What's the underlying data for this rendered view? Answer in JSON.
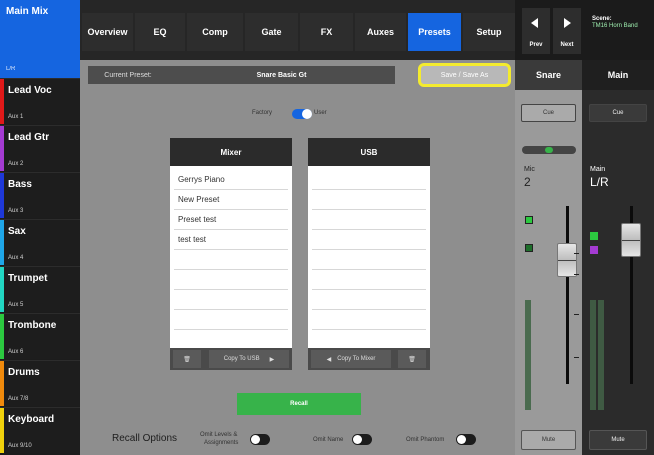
{
  "sidebar": {
    "main_mix": {
      "title": "Main Mix",
      "subtitle": "L/R"
    },
    "items": [
      {
        "name": "Lead Voc",
        "aux": "Aux 1",
        "color": "#e01919"
      },
      {
        "name": "Lead Gtr",
        "aux": "Aux 2",
        "color": "#a43bd2"
      },
      {
        "name": "Bass",
        "aux": "Aux 3",
        "color": "#1e38d8"
      },
      {
        "name": "Sax",
        "aux": "Aux 4",
        "color": "#1fa6e8"
      },
      {
        "name": "Trumpet",
        "aux": "Aux 5",
        "color": "#22d6c2"
      },
      {
        "name": "Trombone",
        "aux": "Aux 6",
        "color": "#2cc940"
      },
      {
        "name": "Drums",
        "aux": "Aux 7/8",
        "color": "#f08a0c"
      },
      {
        "name": "Keyboard",
        "aux": "Aux 9/10",
        "color": "#f0d10c"
      }
    ]
  },
  "tabs": [
    {
      "label": "Overview",
      "active": false
    },
    {
      "label": "EQ",
      "active": false
    },
    {
      "label": "Comp",
      "active": false
    },
    {
      "label": "Gate",
      "active": false
    },
    {
      "label": "FX",
      "active": false
    },
    {
      "label": "Auxes",
      "active": false
    },
    {
      "label": "Presets",
      "active": true
    },
    {
      "label": "Setup",
      "active": false
    }
  ],
  "nav": {
    "prev": "Prev",
    "next": "Next"
  },
  "scene": {
    "label": "Scene:",
    "name": "TM16 Horn Band"
  },
  "presets": {
    "current_label": "Current Preset:",
    "current_name": "Snare Basic Gt",
    "save_button": "Save / Save As",
    "factory_label": "Factory",
    "user_label": "User",
    "mixer": {
      "title": "Mixer",
      "items": [
        "Gerrys Piano",
        "New Preset",
        "Preset test",
        "test test"
      ]
    },
    "usb": {
      "title": "USB",
      "items": []
    },
    "copy_to_usb": "Copy To USB",
    "copy_to_mixer": "Copy To Mixer",
    "recall_button": "Recall",
    "recall_options": "Recall Options",
    "omit_levels": [
      "Omit Levels &",
      "Assignments"
    ],
    "omit_name": "Omit Name",
    "omit_phantom": "Omit Phantom"
  },
  "snare_strip": {
    "title": "Snare",
    "cue": "Cue",
    "input": "Mic",
    "number": "2",
    "mute": "Mute",
    "scale": [
      "0",
      "10",
      "20",
      "40"
    ]
  },
  "main_strip": {
    "title": "Main",
    "cue": "Cue",
    "bus": "Main",
    "bus_name": "L/R",
    "mute": "Mute",
    "scale": [
      "0",
      "10",
      "20",
      "40"
    ]
  },
  "colors": {
    "accent": "#1565e0",
    "highlight": "#f4eb2e",
    "recall": "#37b34a"
  }
}
